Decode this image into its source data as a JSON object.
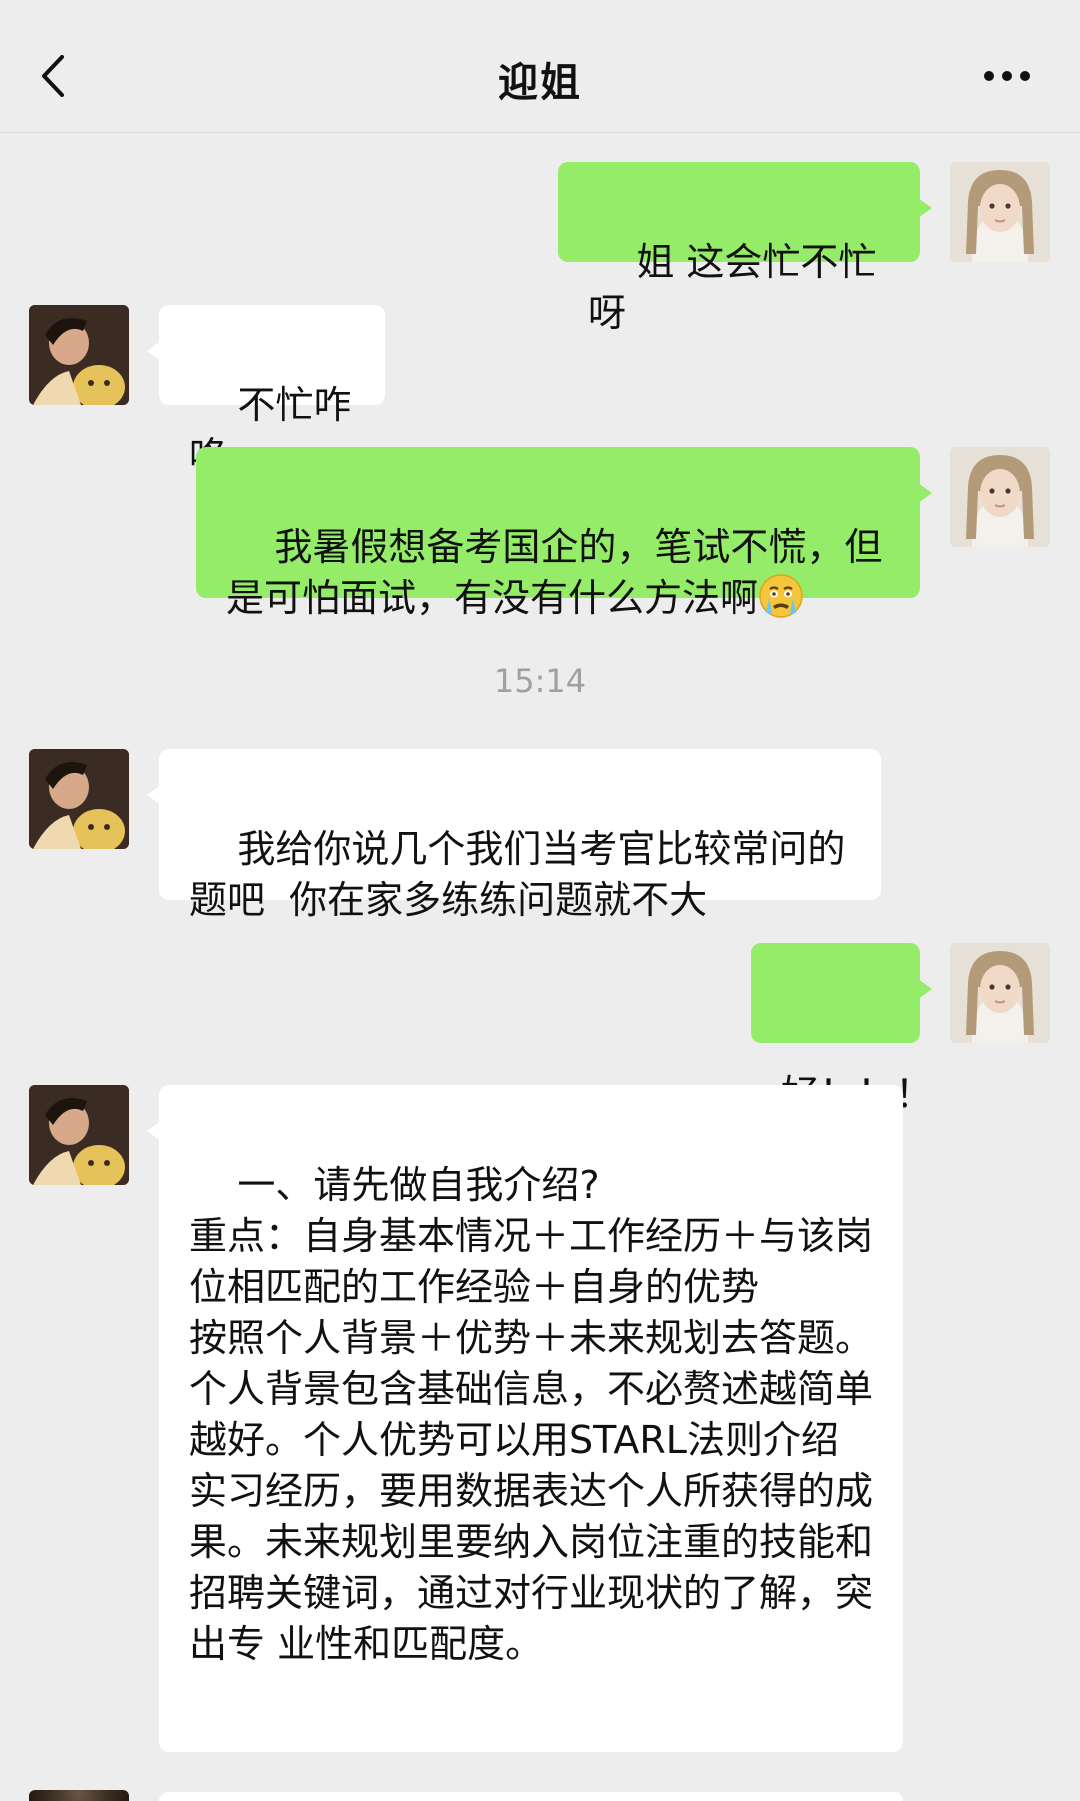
{
  "header": {
    "title": "迎姐"
  },
  "messages": [
    {
      "sender": "me",
      "text": "姐 这会忙不忙呀"
    },
    {
      "sender": "other",
      "text": "不忙咋咯"
    },
    {
      "sender": "me",
      "text": "我暑假想备考国企的，笔试不慌，但是可怕面试，有没有什么方法啊",
      "emoji": "crying-face"
    },
    {
      "sender": "other",
      "text": "我给你说几个我们当考官比较常问的题吧  你在家多练练问题就不大"
    },
    {
      "sender": "me",
      "text": "好！！！"
    },
    {
      "sender": "other",
      "text": "一、请先做自我介绍?\n重点：自身基本情况＋工作经历＋与该岗位相匹配的工作经验＋自身的优势\n按照个人背景＋优势＋未来规划去答题。个人背景包含基础信息，不必赘述越简单越好。个人优势可以用STARL法则介绍实习经历，要用数据表达个人所获得的成果。未来规划里要纳入岗位注重的技能和招聘关键词，通过对行业现状的了解，突出专 业性和匹配度。"
    }
  ],
  "timestamp": "15:14",
  "colors": {
    "background": "#ededed",
    "my_bubble": "#95ec69",
    "other_bubble": "#ffffff"
  }
}
